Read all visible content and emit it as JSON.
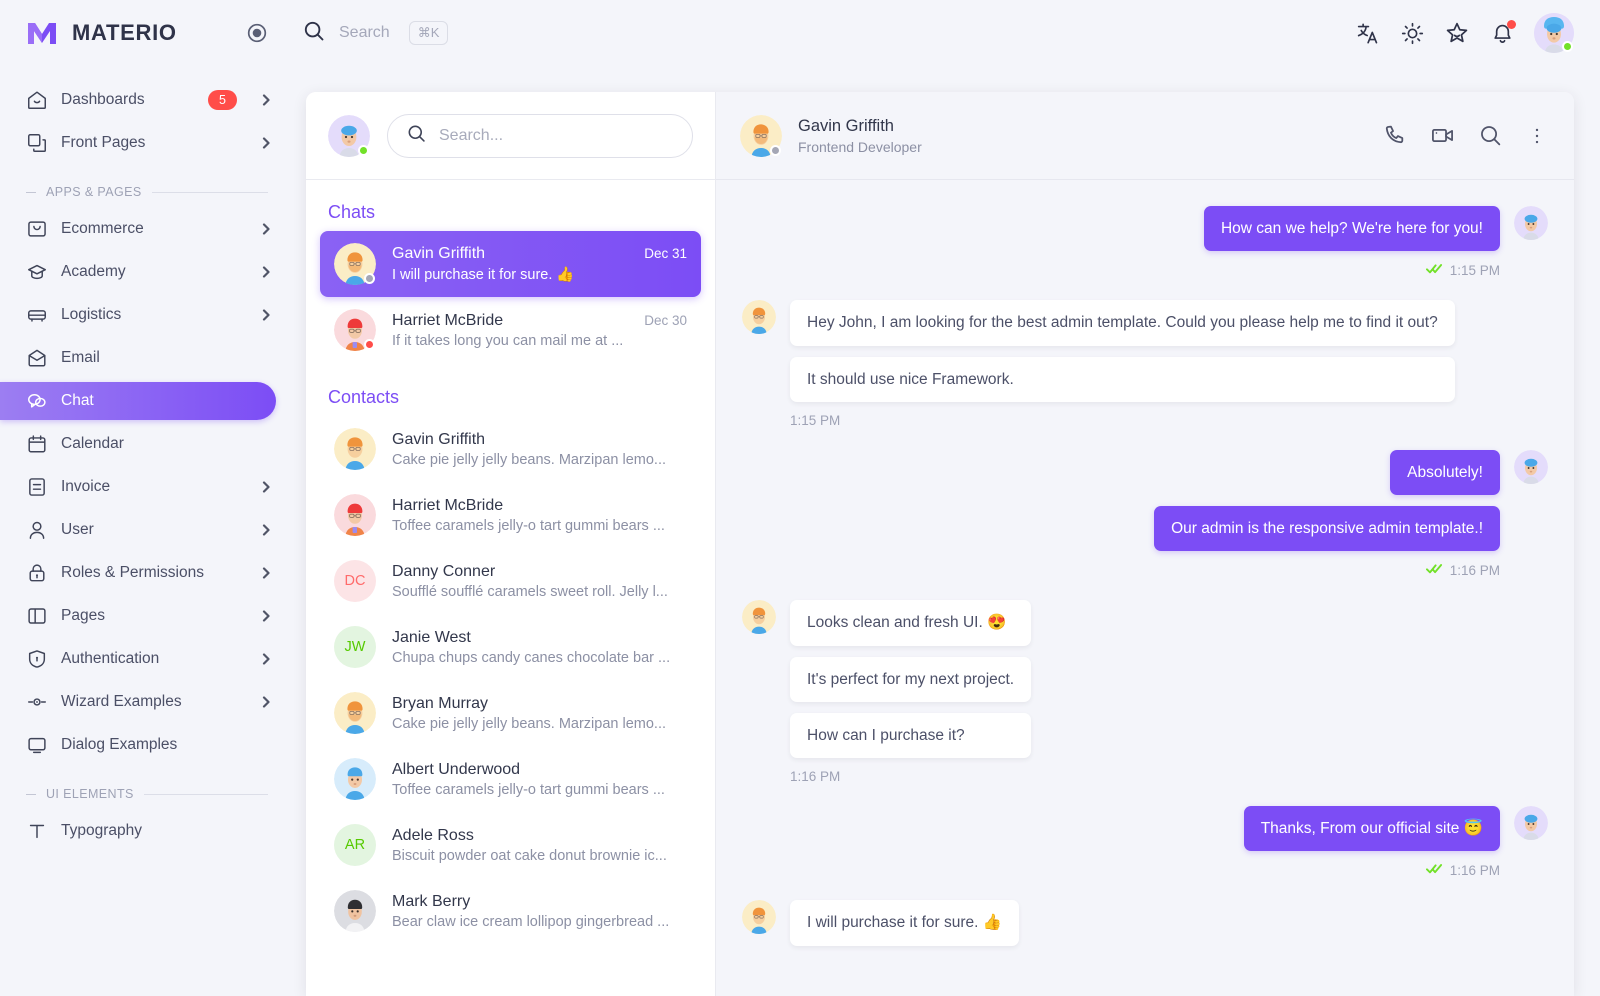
{
  "brand": {
    "name": "MATERIO",
    "logo_icon": "materio-logo",
    "pin_icon": "radio-circle-icon"
  },
  "topbar": {
    "search_label": "Search",
    "search_shortcut": "⌘K",
    "search_icon": "search-icon",
    "icons": [
      {
        "name": "translate-icon",
        "label": "Language"
      },
      {
        "name": "sun-icon",
        "label": "Theme"
      },
      {
        "name": "star-icon",
        "label": "Shortcuts"
      },
      {
        "name": "bell-icon",
        "label": "Notifications",
        "has_dot": true
      }
    ],
    "avatar_status_color": "#72e128"
  },
  "sidebar": {
    "items": [
      {
        "label": "Dashboards",
        "icon": "home-icon",
        "badge": "5",
        "chevron": true,
        "active": false
      },
      {
        "label": "Front Pages",
        "icon": "copy-icon",
        "chevron": true,
        "active": false
      }
    ],
    "sections": [
      {
        "title": "APPS & PAGES",
        "items": [
          {
            "label": "Ecommerce",
            "icon": "shopping-bag-icon",
            "chevron": true,
            "active": false
          },
          {
            "label": "Academy",
            "icon": "graduation-cap-icon",
            "chevron": true,
            "active": false
          },
          {
            "label": "Logistics",
            "icon": "truck-icon",
            "chevron": true,
            "active": false
          },
          {
            "label": "Email",
            "icon": "mail-icon",
            "chevron": false,
            "active": false
          },
          {
            "label": "Chat",
            "icon": "chat-icon",
            "chevron": false,
            "active": true
          },
          {
            "label": "Calendar",
            "icon": "calendar-icon",
            "chevron": false,
            "active": false
          },
          {
            "label": "Invoice",
            "icon": "invoice-icon",
            "chevron": true,
            "active": false
          },
          {
            "label": "User",
            "icon": "user-icon",
            "chevron": true,
            "active": false
          },
          {
            "label": "Roles & Permissions",
            "icon": "lock-icon",
            "chevron": true,
            "active": false
          },
          {
            "label": "Pages",
            "icon": "pages-icon",
            "chevron": true,
            "active": false
          },
          {
            "label": "Authentication",
            "icon": "shield-icon",
            "chevron": true,
            "active": false
          },
          {
            "label": "Wizard Examples",
            "icon": "wizard-icon",
            "chevron": true,
            "active": false
          },
          {
            "label": "Dialog Examples",
            "icon": "dialog-icon",
            "chevron": false,
            "active": false
          }
        ]
      },
      {
        "title": "UI ELEMENTS",
        "items": [
          {
            "label": "Typography",
            "icon": "typography-icon",
            "chevron": false,
            "active": false
          }
        ]
      }
    ]
  },
  "chat_list": {
    "search_placeholder": "Search...",
    "search_value": "",
    "search_icon": "search-icon",
    "chats_title": "Chats",
    "chats": [
      {
        "name": "Gavin Griffith",
        "message": "I will purchase it for sure. 👍",
        "date": "Dec 31",
        "selected": true,
        "status": "#a5a7b5",
        "avatar_bg": "#fbedc6"
      },
      {
        "name": "Harriet McBride",
        "message": "If it takes long you can mail me at ...",
        "date": "Dec 30",
        "selected": false,
        "status": "#ff4d49",
        "avatar_bg": "#fadadd"
      }
    ],
    "contacts_title": "Contacts",
    "contacts": [
      {
        "name": "Gavin Griffith",
        "about": "Cake pie jelly jelly beans. Marzipan lemo...",
        "initials": "",
        "avatar_bg": "#fbedc6",
        "initials_color": ""
      },
      {
        "name": "Harriet McBride",
        "about": "Toffee caramels jelly-o tart gummi bears ...",
        "initials": "",
        "avatar_bg": "#fadadd",
        "initials_color": ""
      },
      {
        "name": "Danny Conner",
        "about": "Soufflé soufflé caramels sweet roll. Jelly l...",
        "initials": "DC",
        "avatar_bg": "#fce4e6",
        "initials_color": "#ff6b6b"
      },
      {
        "name": "Janie West",
        "about": "Chupa chups candy canes chocolate bar ...",
        "initials": "JW",
        "avatar_bg": "#e3f5e0",
        "initials_color": "#56ca00"
      },
      {
        "name": "Bryan Murray",
        "about": "Cake pie jelly jelly beans. Marzipan lemo...",
        "initials": "",
        "avatar_bg": "#fbedc6",
        "initials_color": ""
      },
      {
        "name": "Albert Underwood",
        "about": "Toffee caramels jelly-o tart gummi bears ...",
        "initials": "",
        "avatar_bg": "#d7ecfb",
        "initials_color": ""
      },
      {
        "name": "Adele Ross",
        "about": "Biscuit powder oat cake donut brownie ic...",
        "initials": "AR",
        "avatar_bg": "#e3f5e0",
        "initials_color": "#56ca00"
      },
      {
        "name": "Mark Berry",
        "about": "Bear claw ice cream lollipop gingerbread ...",
        "initials": "",
        "avatar_bg": "#dcdde2",
        "initials_color": ""
      }
    ]
  },
  "conversation": {
    "contact_name": "Gavin Griffith",
    "contact_role": "Frontend Developer",
    "contact_status": "#a5a7b5",
    "actions": [
      {
        "name": "phone-icon",
        "label": "Voice call"
      },
      {
        "name": "video-camera-icon",
        "label": "Video call"
      },
      {
        "name": "search-icon",
        "label": "Search in conversation"
      },
      {
        "name": "more-vertical-icon",
        "label": "More options"
      }
    ],
    "groups": [
      {
        "side": "right",
        "messages": [
          "How can we help? We're here for you!"
        ],
        "time": "1:15 PM",
        "seen": true
      },
      {
        "side": "left",
        "messages": [
          "Hey John, I am looking for the best admin template. Could you please help me to find it out?",
          "It should use nice Framework."
        ],
        "time": "1:15 PM",
        "seen": false
      },
      {
        "side": "right",
        "messages": [
          "Absolutely!",
          "Our admin is the responsive admin template.!"
        ],
        "time": "1:16 PM",
        "seen": true
      },
      {
        "side": "left",
        "messages": [
          "Looks clean and fresh UI. 😍",
          "It's perfect for my next project.",
          "How can I purchase it?"
        ],
        "time": "1:16 PM",
        "seen": false
      },
      {
        "side": "right",
        "messages": [
          "Thanks, From our official site 😇"
        ],
        "time": "1:16 PM",
        "seen": true
      },
      {
        "side": "left",
        "messages": [
          "I will purchase it for sure. 👍"
        ],
        "time": "",
        "seen": false
      }
    ]
  },
  "colors": {
    "primary": "#7c4df5",
    "primary_light": "#9c7ef2",
    "danger": "#ff4d49",
    "success": "#72e128",
    "page_bg": "#f4f5fa",
    "card_bg": "#ffffff",
    "text": "#32374b",
    "muted": "#8c90a4"
  }
}
